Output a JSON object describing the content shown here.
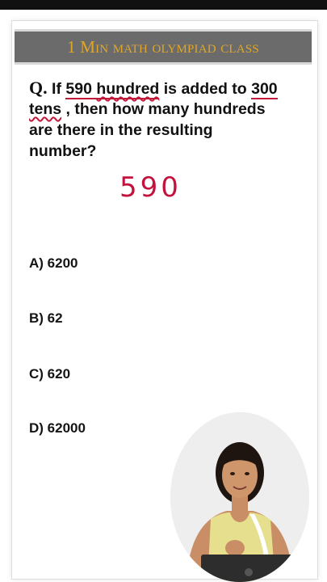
{
  "header": {
    "title": "1 Min math olympiad class"
  },
  "question": {
    "prefix": "Q.",
    "line1_a": " If ",
    "line1_num": "590",
    "line1_space": " ",
    "line1_unit": "hundred",
    "line1_b": " is added to ",
    "line1_c": "300",
    "line2_a": "tens",
    "line2_b": " , then how many hundreds",
    "line3": "are there in the resulting",
    "line4": "number?"
  },
  "handwritten": {
    "value": "590",
    "color": "#c4123e"
  },
  "options": [
    {
      "label": "A) 6200"
    },
    {
      "label": "B) 62"
    },
    {
      "label": "C) 620"
    },
    {
      "label": "D) 62000"
    }
  ],
  "colors": {
    "banner_bg": "#6b6b6b",
    "banner_text": "#e0a62a",
    "underline": "#c2183a"
  },
  "presenter": {
    "icon": "presenter-video"
  }
}
